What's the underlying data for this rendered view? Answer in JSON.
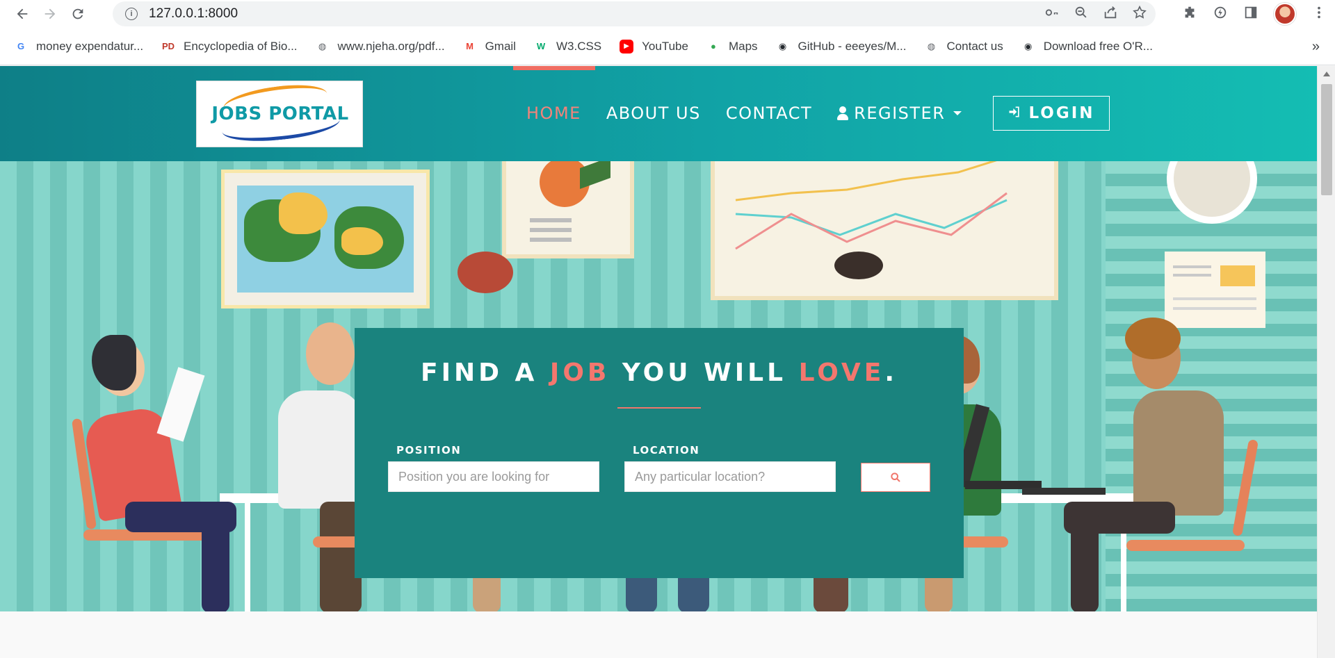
{
  "browser": {
    "url": "127.0.0.1:8000",
    "bookmarks": [
      {
        "label": "money expendatur...",
        "icon": "google-icon",
        "color": "#4285f4"
      },
      {
        "label": "Encyclopedia of Bio...",
        "icon": "pd-icon",
        "color": "#c0392b"
      },
      {
        "label": "www.njeha.org/pdf...",
        "icon": "globe-icon",
        "color": "#5f6368"
      },
      {
        "label": "Gmail",
        "icon": "gmail-icon",
        "color": "#ea4335"
      },
      {
        "label": "W3.CSS",
        "icon": "w3-icon",
        "color": "#04aa6d"
      },
      {
        "label": "YouTube",
        "icon": "youtube-icon",
        "color": "#ff0000"
      },
      {
        "label": "Maps",
        "icon": "maps-pin-icon",
        "color": "#34a853"
      },
      {
        "label": "GitHub - eeeyes/M...",
        "icon": "github-icon",
        "color": "#24292e"
      },
      {
        "label": "Contact us",
        "icon": "globe-icon",
        "color": "#5f6368"
      },
      {
        "label": "Download free O'R...",
        "icon": "github-icon",
        "color": "#24292e"
      }
    ],
    "more": "»"
  },
  "site": {
    "logo_text": "JOBS PORTAL",
    "nav": {
      "home": "HOME",
      "about": "ABOUT US",
      "contact": "CONTACT",
      "register": "REGISTER",
      "login": "LOGIN"
    },
    "colors": {
      "header_start": "#0e7f87",
      "header_end": "#14bdb3",
      "accent": "#f0766b",
      "card": "#1a837e"
    }
  },
  "hero": {
    "headline": {
      "part1": "FIND A ",
      "highlight1": "JOB",
      "part2": " YOU WILL ",
      "highlight2": "LOVE",
      "part3": "."
    },
    "position_label": "POSITION",
    "position_placeholder": "Position you are looking for",
    "location_label": "LOCATION",
    "location_placeholder": "Any particular location?"
  }
}
